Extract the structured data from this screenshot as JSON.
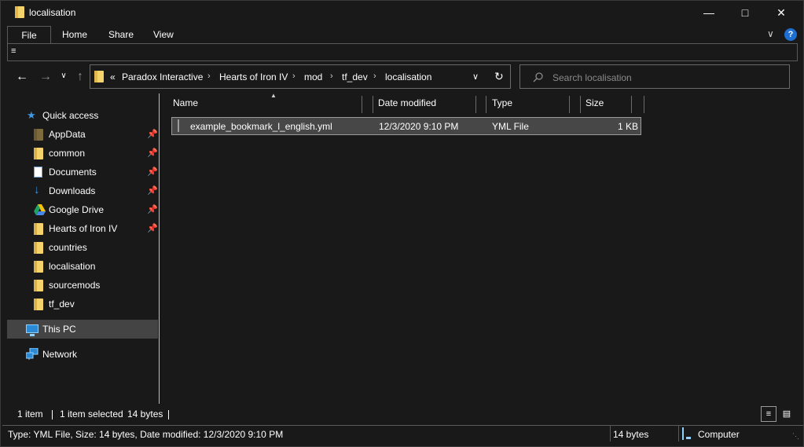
{
  "window": {
    "title": "localisation"
  },
  "ribbon": {
    "tabs": [
      {
        "label": "File"
      },
      {
        "label": "Home"
      },
      {
        "label": "Share"
      },
      {
        "label": "View"
      }
    ],
    "qat_glyph": "≡",
    "collapse_glyph": "∨",
    "help_glyph": "?"
  },
  "controls": {
    "minimize": "—",
    "maximize": "□",
    "close": "✕"
  },
  "address": {
    "overflow": "«",
    "crumbs": [
      "Paradox Interactive",
      "Hearts of Iron IV",
      "mod",
      "tf_dev",
      "localisation"
    ],
    "separator": "›"
  },
  "search": {
    "placeholder": "Search localisation"
  },
  "nav": {
    "quick_access": "Quick access",
    "items": [
      {
        "label": "AppData",
        "pinned": true
      },
      {
        "label": "common",
        "pinned": true
      },
      {
        "label": "Documents",
        "pinned": true
      },
      {
        "label": "Downloads",
        "pinned": true
      },
      {
        "label": "Google Drive",
        "pinned": true
      },
      {
        "label": "Hearts of Iron IV",
        "pinned": true
      },
      {
        "label": "countries",
        "pinned": false
      },
      {
        "label": "localisation",
        "pinned": false
      },
      {
        "label": "sourcemods",
        "pinned": false
      },
      {
        "label": "tf_dev",
        "pinned": false
      }
    ],
    "this_pc": "This PC",
    "network": "Network"
  },
  "columns": [
    "Name",
    "Date modified",
    "Type",
    "Size"
  ],
  "files": [
    {
      "name": "example_bookmark_l_english.yml",
      "date": "12/3/2020 9:10 PM",
      "type": "YML File",
      "size": "1 KB"
    }
  ],
  "status": {
    "count": "1 item",
    "selected": "1 item selected",
    "bytes": "14 bytes"
  },
  "details_bar": {
    "info": "Type: YML File, Size: 14 bytes, Date modified: 12/3/2020 9:10 PM",
    "size": "14 bytes",
    "location": "Computer"
  },
  "colors": {
    "background": "#191919",
    "selection": "#474747",
    "accent": "#1e6fd1"
  }
}
